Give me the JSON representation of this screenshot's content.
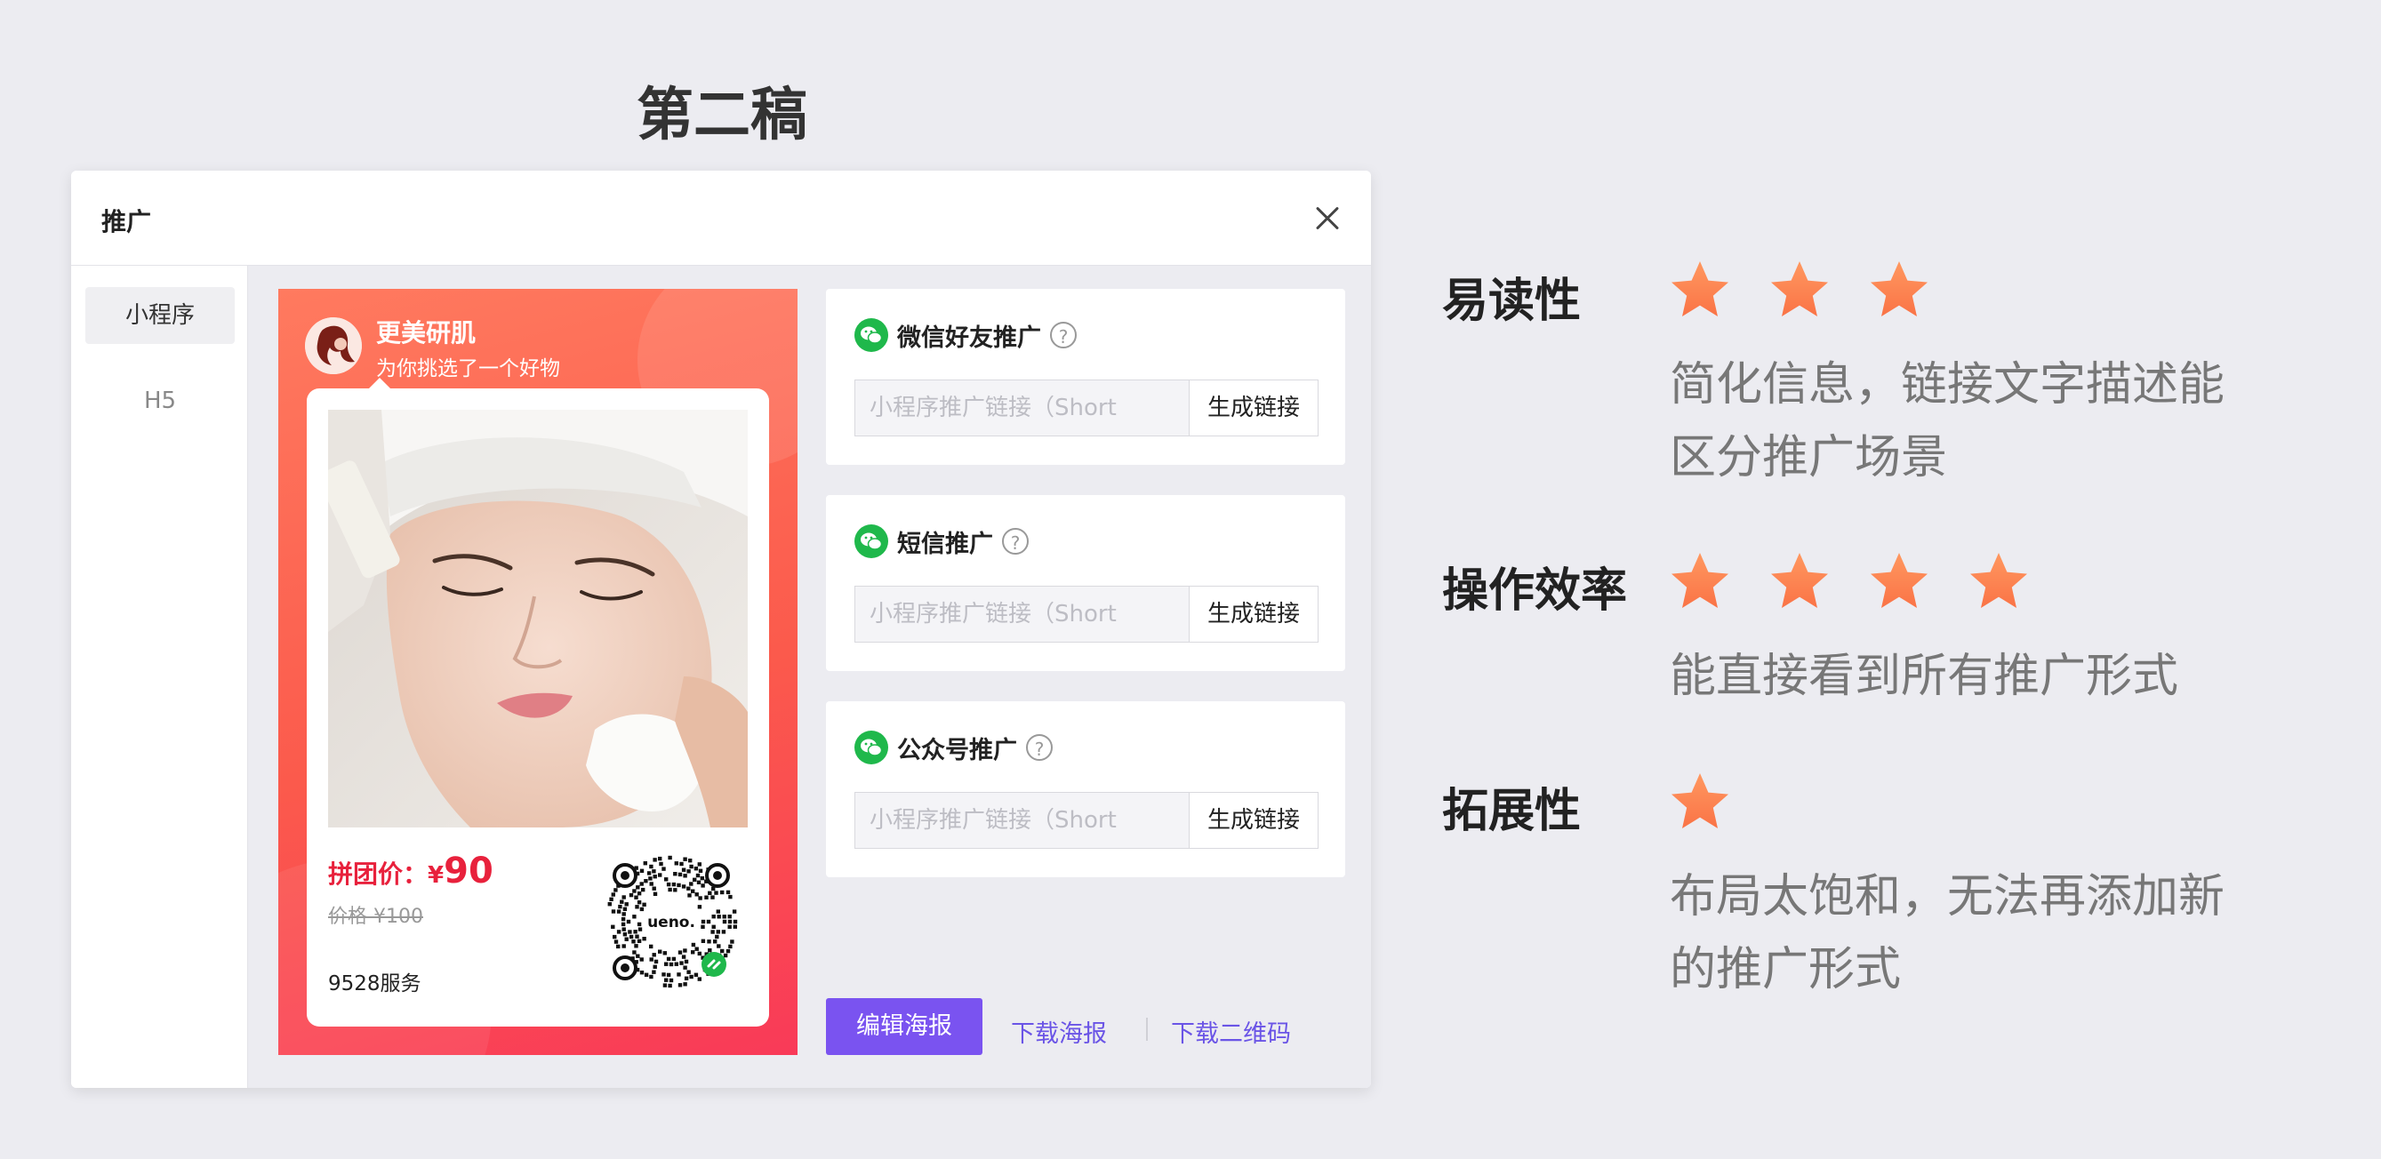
{
  "page_title": "第二稿",
  "dialog": {
    "title": "推广",
    "sidebar": [
      {
        "label": "小程序",
        "active": true
      },
      {
        "label": "H5",
        "active": false
      }
    ],
    "poster": {
      "brand_name": "更美研肌",
      "brand_sub": "为你挑选了一个好物",
      "price_label": "拼团价：",
      "price_currency": "¥",
      "price_value": "90",
      "original_price": "价格 ¥100",
      "service": "9528服务",
      "qr_brand": "ueno."
    },
    "promos": [
      {
        "title": "微信好友推广",
        "placeholder": "小程序推广链接（Short",
        "button": "生成链接"
      },
      {
        "title": "短信推广",
        "placeholder": "小程序推广链接（Short",
        "button": "生成链接"
      },
      {
        "title": "公众号推广",
        "placeholder": "小程序推广链接（Short",
        "button": "生成链接"
      }
    ],
    "actions": {
      "edit_poster": "编辑海报",
      "download_poster": "下载海报",
      "download_qr": "下载二维码"
    }
  },
  "ratings": [
    {
      "label": "易读性",
      "stars": 3,
      "desc_lines": [
        "简化信息，链接文字描述能",
        "区分推广场景"
      ]
    },
    {
      "label": "操作效率",
      "stars": 4,
      "desc_lines": [
        "能直接看到所有推广形式"
      ]
    },
    {
      "label": "拓展性",
      "stars": 1,
      "desc_lines": [
        "布局太饱和，无法再添加新",
        "的推广形式"
      ]
    }
  ],
  "colors": {
    "accent": "#7a53f0",
    "link": "#6a54e6",
    "price": "#e8213c",
    "wechat": "#1fb84b",
    "star": "#fa7346"
  }
}
